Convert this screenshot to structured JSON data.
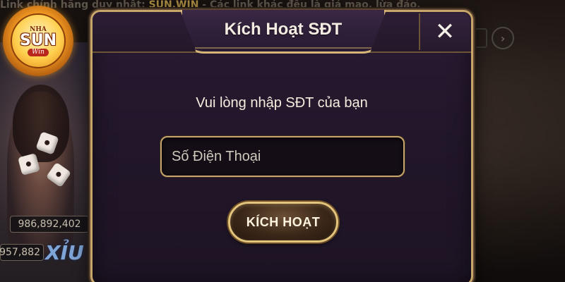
{
  "background": {
    "marquee_prefix": "Link chính hãng duy nhất: ",
    "marquee_link": "SUN.WIN",
    "marquee_suffix": " - Các link khác đều là giả mạo, lừa đảo.",
    "logo": {
      "small_text": "NHA",
      "brand": "SUN",
      "sub": "Win"
    },
    "jackpot_amount_1": "986,892,402",
    "jackpot_amount_2": "957,882",
    "side_label": "XỈU"
  },
  "dialog": {
    "title": "Kích Hoạt SĐT",
    "close_icon": "close-icon",
    "prompt": "Vui lòng nhập SĐT của bạn",
    "phone_input": {
      "value": "",
      "placeholder": "Số Điện Thoại"
    },
    "activate_label": "KÍCH HOẠT"
  },
  "colors": {
    "gold_border": "#c8a66a",
    "dialog_bg": "#22172b",
    "text_light": "#f4eedf"
  }
}
